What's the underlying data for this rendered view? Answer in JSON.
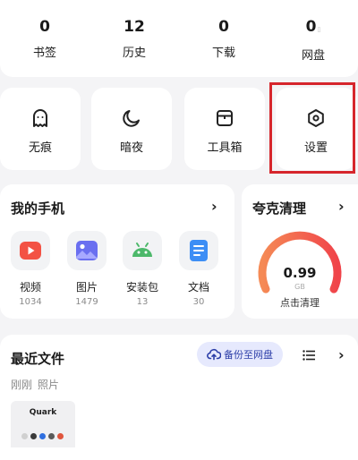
{
  "stats": [
    {
      "value": "0",
      "label": "书签"
    },
    {
      "value": "12",
      "label": "历史"
    },
    {
      "value": "0",
      "label": "下载"
    },
    {
      "value": "0",
      "label": "网盘"
    }
  ],
  "tools": [
    {
      "label": "无痕",
      "icon": "ghost-icon"
    },
    {
      "label": "暗夜",
      "icon": "moon-icon"
    },
    {
      "label": "工具箱",
      "icon": "toolbox-icon"
    },
    {
      "label": "设置",
      "icon": "settings-hexagon-icon"
    }
  ],
  "phone": {
    "title": "我的手机",
    "apps": [
      {
        "label": "视频",
        "count": "1034",
        "icon": "video-icon",
        "color": "#f35244"
      },
      {
        "label": "图片",
        "count": "1479",
        "icon": "image-icon",
        "color": "#6a6ff0"
      },
      {
        "label": "安装包",
        "count": "13",
        "icon": "android-icon",
        "color": "#4cb86a"
      },
      {
        "label": "文档",
        "count": "30",
        "icon": "document-icon",
        "color": "#3d8ef5"
      }
    ]
  },
  "cleanup": {
    "title": "夸克清理",
    "value": "0.99",
    "unit": "GB",
    "button": "点击清理",
    "accent": "#f26a4a"
  },
  "recent": {
    "title": "最近文件",
    "backup_label": "备份至网盘",
    "sub_labels": [
      "刚刚",
      "照片"
    ],
    "thumb_title": "Quark"
  },
  "colors": {
    "highlight": "#d6262c",
    "backup_bg": "#e6e9fd"
  }
}
